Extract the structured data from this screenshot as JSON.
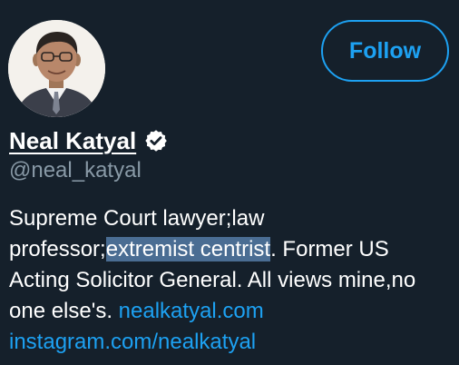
{
  "profile": {
    "display_name": "Neal Katyal",
    "handle": "@neal_katyal",
    "verified": true,
    "follow_label": "Follow",
    "avatar_icon": "profile-photo",
    "bio": {
      "part1": "Supreme Court lawyer;law professor;",
      "highlighted": "extremist centrist",
      "part2": ". Former US Acting Solicitor General. All views mine,no one else's.",
      "link1": "nealkatyal.com",
      "link2": "instagram.com/nealkatyal"
    }
  },
  "colors": {
    "background": "#15202b",
    "accent": "#1da1f2",
    "muted": "#8899a6",
    "selection": "#4a6d93"
  }
}
